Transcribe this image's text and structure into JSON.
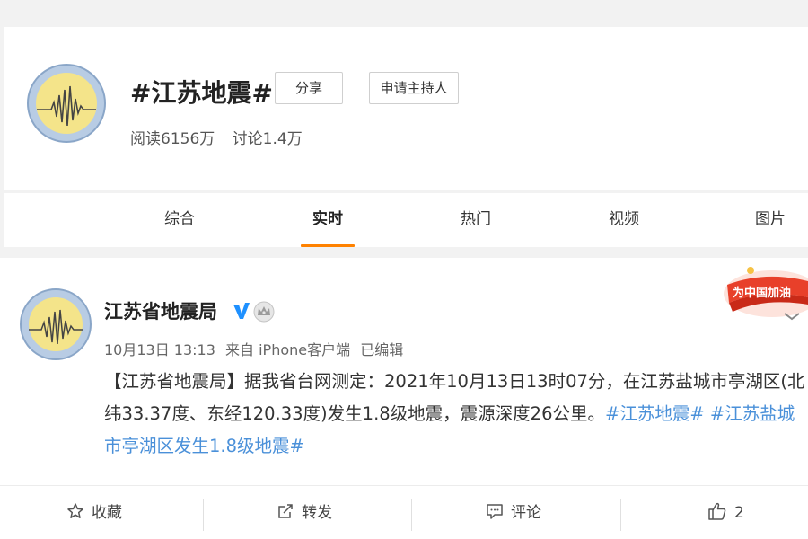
{
  "topic": {
    "title": "#江苏地震#",
    "share_label": "分享",
    "apply_host_label": "申请主持人",
    "reads": "阅读6156万",
    "discussions": "讨论1.4万"
  },
  "tabs": [
    {
      "label": "综合",
      "active": false
    },
    {
      "label": "实时",
      "active": true
    },
    {
      "label": "热门",
      "active": false
    },
    {
      "label": "视频",
      "active": false
    },
    {
      "label": "图片",
      "active": false
    }
  ],
  "post": {
    "author": "江苏省地震局",
    "time": "10月13日 13:13",
    "source": "来自 iPhone客户端",
    "edited": "已编辑",
    "text_main": "【江苏省地震局】据我省台网测定：2021年10月13日13时07分，在江苏盐城市亭湖区(北纬33.37度、东经120.33度)发生1.8级地震，震源深度26公里。",
    "hashtag_1": "#江苏地震#",
    "hashtag_2": "#江苏盐城市亭湖区发生1.8级地震#",
    "badge_text": "为中国加油"
  },
  "actions": {
    "favorite": "收藏",
    "repost": "转发",
    "comment": "评论",
    "like_count": "2"
  },
  "colors": {
    "accent_orange": "#ff8200",
    "link_blue": "#4a90d9",
    "verified_blue": "#1e90ff"
  }
}
